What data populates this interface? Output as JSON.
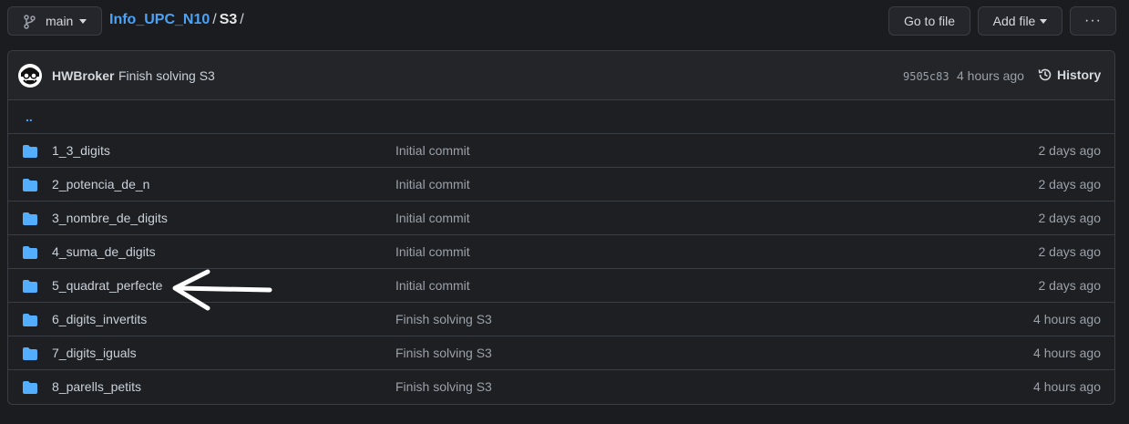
{
  "toolbar": {
    "branch_label": "main",
    "goto_label": "Go to file",
    "addfile_label": "Add file",
    "more_label": "···"
  },
  "breadcrumb": {
    "repo": "Info_UPC_N10",
    "sep1": "/",
    "folder": "S3",
    "sep2": "/"
  },
  "commit": {
    "author": "HWBroker",
    "message": "Finish solving S3",
    "sha": "9505c83",
    "time": "4 hours ago",
    "history_label": "History"
  },
  "parent_link": "..",
  "files": [
    {
      "name": "1_3_digits",
      "message": "Initial commit",
      "age": "2 days ago"
    },
    {
      "name": "2_potencia_de_n",
      "message": "Initial commit",
      "age": "2 days ago"
    },
    {
      "name": "3_nombre_de_digits",
      "message": "Initial commit",
      "age": "2 days ago"
    },
    {
      "name": "4_suma_de_digits",
      "message": "Initial commit",
      "age": "2 days ago"
    },
    {
      "name": "5_quadrat_perfecte",
      "message": "Initial commit",
      "age": "2 days ago"
    },
    {
      "name": "6_digits_invertits",
      "message": "Finish solving S3",
      "age": "4 hours ago"
    },
    {
      "name": "7_digits_iguals",
      "message": "Finish solving S3",
      "age": "4 hours ago"
    },
    {
      "name": "8_parells_petits",
      "message": "Finish solving S3",
      "age": "4 hours ago"
    }
  ],
  "colors": {
    "background": "#1b1c1f",
    "link": "#4ba3f7",
    "folder_icon": "#54aeff",
    "border": "#3a3d43",
    "annotation_arrow": "#ffffff"
  },
  "icons": {
    "branch": "git-branch-icon",
    "history": "history-clock-icon",
    "folder": "folder-icon",
    "annotation": "arrow-left-icon"
  }
}
